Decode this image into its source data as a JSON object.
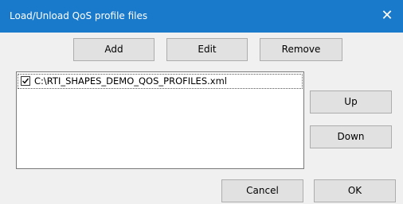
{
  "window": {
    "title": "Load/Unload QoS profile files",
    "close_glyph": "✕"
  },
  "toolbar": {
    "add_label": "Add",
    "edit_label": "Edit",
    "remove_label": "Remove"
  },
  "file_list": {
    "items": [
      {
        "label": "C:\\RTI_SHAPES_DEMO_QOS_PROFILES.xml",
        "checked": true
      }
    ]
  },
  "side_buttons": {
    "up_label": "Up",
    "down_label": "Down"
  },
  "footer": {
    "cancel_label": "Cancel",
    "ok_label": "OK"
  },
  "colors": {
    "titlebar": "#1979ca",
    "dialog_bg": "#f0f0f0",
    "button_bg": "#e1e1e1"
  }
}
